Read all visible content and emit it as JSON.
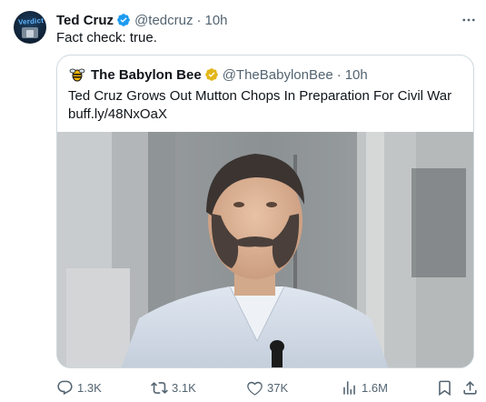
{
  "tweet": {
    "author": {
      "name": "Ted Cruz",
      "handle": "@tedcruz",
      "time": "10h",
      "avatar_text": "Verdict"
    },
    "separator": "·",
    "text": "Fact check: true.",
    "quote": {
      "author": {
        "name": "The Babylon Bee",
        "handle": "@TheBabylonBee",
        "time": "10h"
      },
      "text": "Ted Cruz Grows Out Mutton Chops In Preparation For Civil War buff.ly/48NxOaX"
    },
    "stats": {
      "replies": "1.3K",
      "retweets": "3.1K",
      "likes": "37K",
      "views": "1.6M"
    }
  },
  "colors": {
    "verified_blue": "#1d9bf0",
    "verified_gold": "#e2b719",
    "secondary_text": "#536471",
    "border": "#cfd9de"
  }
}
